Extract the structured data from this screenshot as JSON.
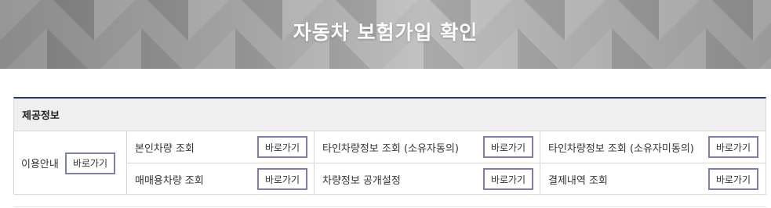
{
  "banner": {
    "title": "자동차 보험가입 확인"
  },
  "panel": {
    "heading": "제공정보",
    "intro": {
      "label": "이용안내",
      "button": "바로가기"
    },
    "services": [
      {
        "label": "본인차량 조회",
        "button": "바로가기"
      },
      {
        "label": "타인차량정보 조회 (소유자동의)",
        "button": "바로가기"
      },
      {
        "label": "타인차량정보 조회 (소유자미동의)",
        "button": "바로가기"
      },
      {
        "label": "매매용차량 조회",
        "button": "바로가기"
      },
      {
        "label": "차량정보 공개설정",
        "button": "바로가기"
      },
      {
        "label": "결제내역 조회",
        "button": "바로가기"
      }
    ]
  },
  "colors": {
    "accent_border": "#1f3a5f",
    "button_border": "#7b7fb3"
  }
}
